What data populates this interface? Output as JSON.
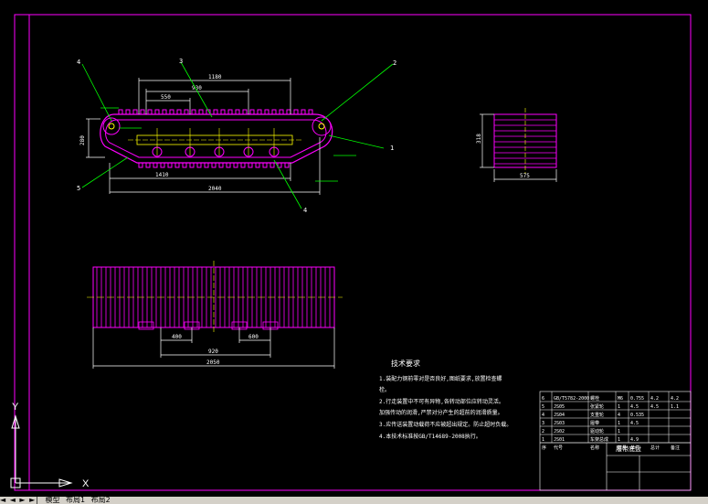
{
  "colors": {
    "background": "#000000",
    "frame": "#ff00ff",
    "object": "#ff00ff",
    "dimension": "#ffffff",
    "leader": "#00ff00",
    "center": "#ffff00",
    "hatch": "#ffffff",
    "text": "#ffffff"
  },
  "callouts": {
    "top_left": "4",
    "top_middle": "3",
    "top_right": "2",
    "right_low": "1",
    "bottom_left": "5",
    "bottom_mid": "4"
  },
  "dims": {
    "overall_top": "1180",
    "spacing_a": "930",
    "spacing_b": "550",
    "lower_a": "1410",
    "overall_bottom": "2040",
    "height_left": "280",
    "side_height": "318",
    "side_width": "575",
    "plan_left": "400",
    "plan_right": "600",
    "plan_mid": "920",
    "plan_total": "2050"
  },
  "notes": {
    "title": "技术要求",
    "lines": [
      "1.装配力钢前零对是否良好,图纸要求,放置检查螺",
      "栓。",
      "2.行走装置中不可有异物,各转动部位应转动灵活。",
      "加强传动的润滑,严禁对分产生的超前的润滑质量。",
      "3.应传送装置动载荷不应被超出规定。防止超时负载。",
      "4.本技术标准按GB/T14689-2008执行。"
    ]
  },
  "title_block": {
    "drawing_name": "履带底盘",
    "rows": [
      [
        "6",
        "GB/T5782-2000",
        "螺栓",
        "M6",
        "0.755",
        "4.2",
        "4.2"
      ],
      [
        "5",
        "JS05",
        "张紧轮",
        "1",
        "4.5",
        "4.5",
        "1.1"
      ],
      [
        "4",
        "JS04",
        "支重轮",
        "4",
        "0.535",
        "",
        ""
      ],
      [
        "3",
        "JS03",
        "履带",
        "1",
        "4.5",
        "",
        ""
      ],
      [
        "2",
        "JS02",
        "驱动轮",
        "1",
        "",
        "",
        ""
      ],
      [
        "1",
        "JS01",
        "车架总成",
        "1",
        "4.9",
        "",
        ""
      ]
    ],
    "header": [
      "序",
      "代号",
      "名称",
      "数量",
      "单件",
      "总计",
      "备注"
    ]
  },
  "ucs": {
    "y_label": "Y",
    "x_label": "X"
  },
  "tabs": {
    "nav": "◄ ◄ ► ►|",
    "model": "模型",
    "layout1": "布局1",
    "layout2": "布局2"
  }
}
